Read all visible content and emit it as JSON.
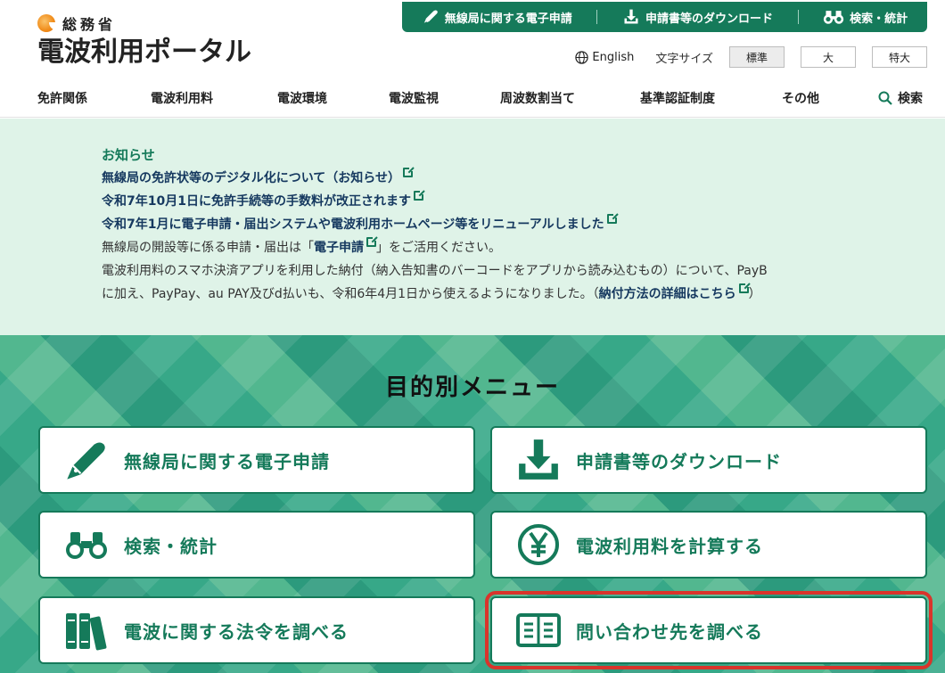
{
  "header": {
    "ministry": "総務省",
    "portal_name": "電波利用ポータル",
    "topbar": [
      {
        "label": "無線局に関する電子申請",
        "icon": "pen-icon"
      },
      {
        "label": "申請書等のダウンロード",
        "icon": "download-icon"
      },
      {
        "label": "検索・統計",
        "icon": "binoculars-icon"
      }
    ],
    "english": "English",
    "font_size_label": "文字サイズ",
    "font_sizes": [
      "標準",
      "大",
      "特大"
    ],
    "nav": [
      "免許関係",
      "電波利用料",
      "電波環境",
      "電波監視",
      "周波数割当て",
      "基準認証制度",
      "その他"
    ],
    "search_label": "検索"
  },
  "notice": {
    "title": "お知らせ",
    "links": [
      "無線局の免許状等のデジタル化について（お知らせ）",
      "令和7年10月1日に免許手続等の手数料が改正されます",
      "令和7年1月に電子申請・届出システムや電波利用ホームページ等をリニューアルしました"
    ],
    "line4_pre": "無線局の開設等に係る申請・届出は「",
    "line4_link": "電子申請",
    "line4_post": "」をご活用ください。",
    "line5": "電波利用料のスマホ決済アプリを利用した納付（納入告知書のバーコードをアプリから読み込むもの）について、PayB",
    "line6_pre": "に加え、PayPay、au PAY及びd払いも、令和6年4月1日から使えるようになりました。（",
    "line6_link": "納付方法の詳細はこちら",
    "line6_post": "）"
  },
  "menu": {
    "title": "目的別メニュー",
    "items": [
      {
        "label": "無線局に関する電子申請",
        "icon": "pen-icon"
      },
      {
        "label": "申請書等のダウンロード",
        "icon": "download-icon"
      },
      {
        "label": "検索・統計",
        "icon": "binoculars-icon"
      },
      {
        "label": "電波利用料を計算する",
        "icon": "yen-icon"
      },
      {
        "label": "電波に関する法令を調べる",
        "icon": "books-icon"
      },
      {
        "label": "問い合わせ先を調べる",
        "icon": "open-book-icon"
      }
    ]
  },
  "colors": {
    "brand_green": "#157a5a",
    "notice_bg": "#dff3e8",
    "link_navy": "#15385f",
    "highlight_red": "#d9342b"
  }
}
